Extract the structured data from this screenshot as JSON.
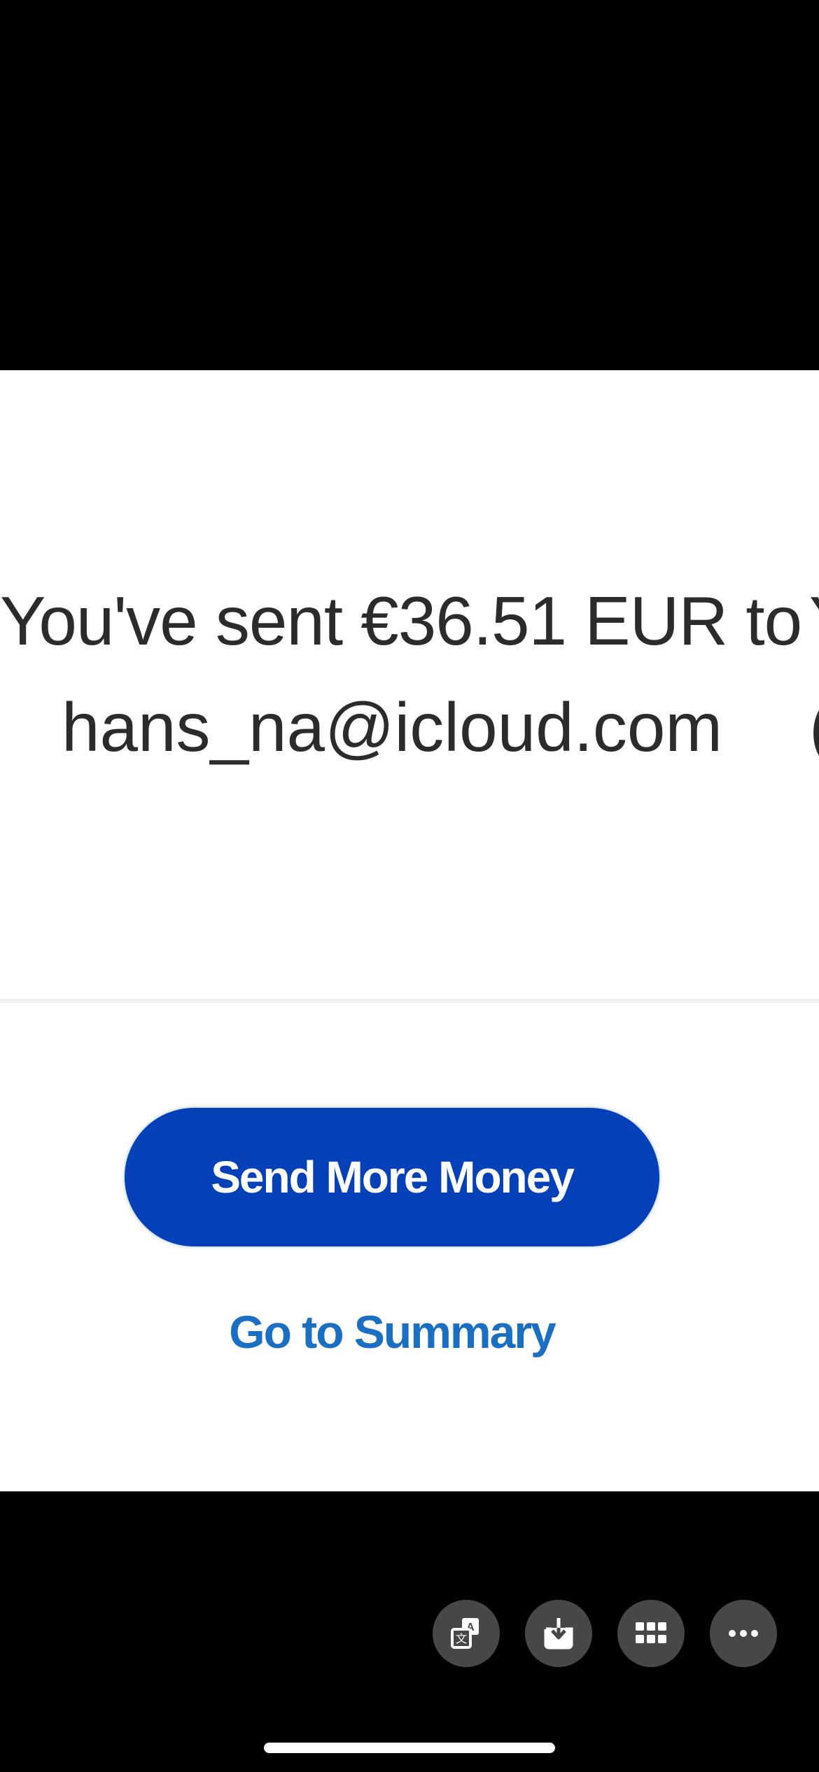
{
  "confirmation": {
    "line1": "You've sent €36.51 EUR to",
    "line2": "hans_na@icloud.com",
    "next_page_peek_line1": "Y",
    "next_page_peek_line2": "("
  },
  "actions": {
    "primary_label": "Send More Money",
    "secondary_label": "Go to Summary"
  },
  "toolbar": {
    "buttons": [
      {
        "icon": "translate-icon"
      },
      {
        "icon": "save-icon"
      },
      {
        "icon": "grid-icon"
      },
      {
        "icon": "more-icon"
      }
    ]
  },
  "colors": {
    "primary_button": "#0441b8",
    "link": "#1a6fc2",
    "text": "#2b2b2b",
    "toolbar_button": "#474747"
  }
}
